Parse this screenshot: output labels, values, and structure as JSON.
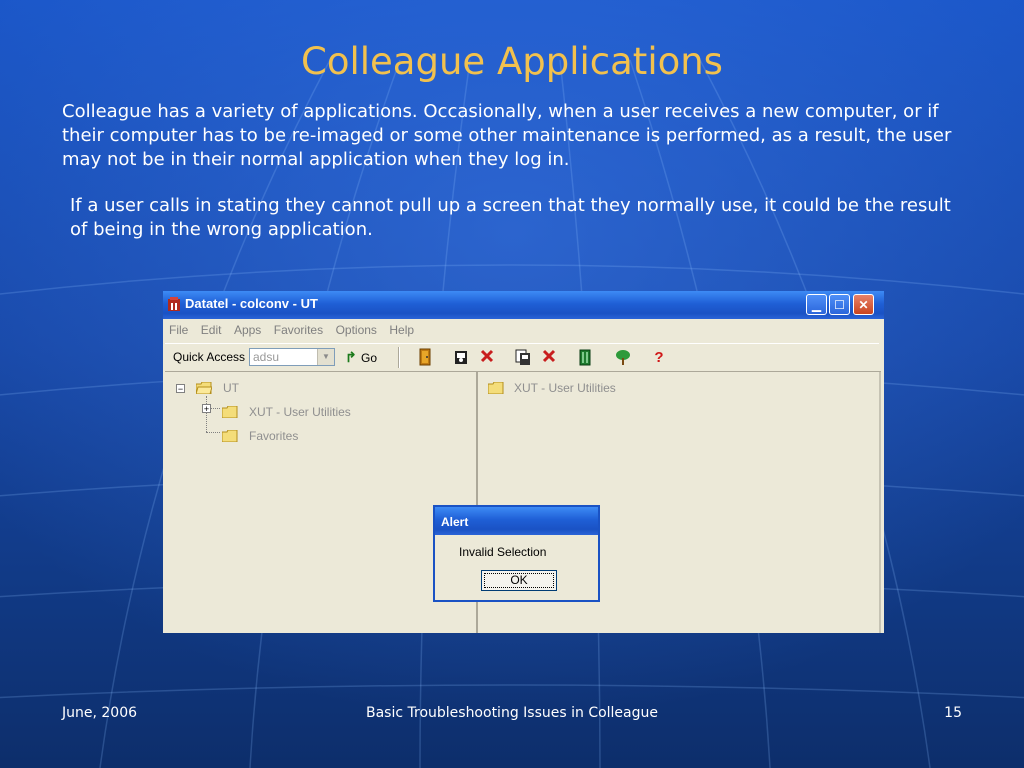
{
  "slide": {
    "title": "Colleague Applications",
    "paragraph1": "Colleague has a variety of applications.  Occasionally, when a user receives a new computer, or if their computer has to be re-imaged or some other maintenance is performed, as a result, the user may not be in their normal application when they log in.",
    "paragraph2": "If a user calls in stating they cannot pull up a screen that they normally use, it could be the result of being in the wrong application.",
    "footer_left": "June, 2006",
    "footer_center": "Basic Troubleshooting Issues in Colleague",
    "footer_right": "15"
  },
  "window": {
    "title": "Datatel - colconv - UT",
    "menu": [
      "File",
      "Edit",
      "Apps",
      "Favorites",
      "Options",
      "Help"
    ],
    "quick_access_label": "Quick Access",
    "quick_access_value": "adsu",
    "go_label": "Go",
    "toolbar_icons": [
      "exit-door-icon",
      "lock-person-icon",
      "delete-x-icon",
      "copy-lock-icon",
      "cancel-x-icon",
      "green-door-icon",
      "tree-icon",
      "help-question-icon"
    ],
    "tree": {
      "root": "UT",
      "children": [
        "XUT - User Utilities",
        "Favorites"
      ]
    },
    "right_pane_item": "XUT - User Utilities"
  },
  "alert": {
    "title": "Alert",
    "message": "Invalid Selection",
    "ok_label": "OK"
  },
  "colors": {
    "title_text": "#f2c14e",
    "background": "#1747a6",
    "xp_titlebar": "#1f5fd6"
  }
}
